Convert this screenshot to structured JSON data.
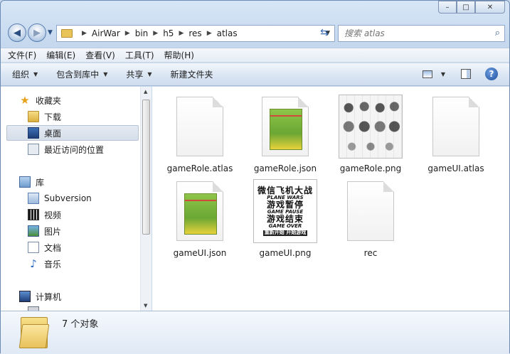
{
  "window": {
    "minimize": "–",
    "maximize": "□",
    "close": "✕"
  },
  "address": {
    "crumbs": [
      "AirWar",
      "bin",
      "h5",
      "res",
      "atlas"
    ]
  },
  "search": {
    "placeholder": "搜索 atlas"
  },
  "menu": [
    "文件(F)",
    "编辑(E)",
    "查看(V)",
    "工具(T)",
    "帮助(H)"
  ],
  "commands": [
    {
      "label": "组织",
      "has_menu": true
    },
    {
      "label": "包含到库中",
      "has_menu": true
    },
    {
      "label": "共享",
      "has_menu": true
    },
    {
      "label": "新建文件夹",
      "has_menu": false
    }
  ],
  "nav": {
    "favorites": {
      "label": "收藏夹",
      "items": [
        "下载",
        "桌面",
        "最近访问的位置"
      ]
    },
    "libraries": {
      "label": "库",
      "items": [
        "Subversion",
        "视频",
        "图片",
        "文档",
        "音乐"
      ]
    },
    "computer": {
      "label": "计算机"
    }
  },
  "files": [
    {
      "name": "gameRole.atlas",
      "type": "blank"
    },
    {
      "name": "gameRole.json",
      "type": "json"
    },
    {
      "name": "gameRole.png",
      "type": "sprite"
    },
    {
      "name": "gameUI.atlas",
      "type": "blank"
    },
    {
      "name": "gameUI.json",
      "type": "json"
    },
    {
      "name": "gameUI.png",
      "type": "uipng"
    },
    {
      "name": "rec",
      "type": "blank"
    }
  ],
  "ui_png_text": {
    "line1": "微信飞机大战",
    "line2": "PLANE WARS",
    "line3": "游戏暂停",
    "line4": "GAME PAUSE",
    "line5": "游戏结束",
    "line6": "GAME OVER",
    "line7": "重新开始 开始游戏"
  },
  "details": {
    "text": "7 个对象"
  }
}
